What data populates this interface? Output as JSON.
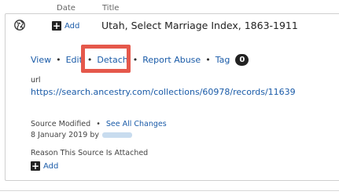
{
  "header": {
    "date_label": "Date",
    "title_label": "Title"
  },
  "source": {
    "globe_icon": "globe-icon",
    "add_label": "Add",
    "title": "Utah, Select Marriage Index, 1863-1911",
    "actions": {
      "view": "View",
      "edit": "Edit",
      "detach": "Detach",
      "report_abuse": "Report Abuse",
      "tag": "Tag",
      "tag_count": "0",
      "separator": "•"
    },
    "highlight_color": "#e5584b",
    "url_label": "url",
    "url": "https://search.ancestry.com/collections/60978/records/11639",
    "source_modified_label": "Source Modified",
    "see_all_changes": "See All Changes",
    "modified_date": "8 January 2019",
    "by_label": "by",
    "reason_label": "Reason This Source Is Attached",
    "reason_add_label": "Add"
  }
}
